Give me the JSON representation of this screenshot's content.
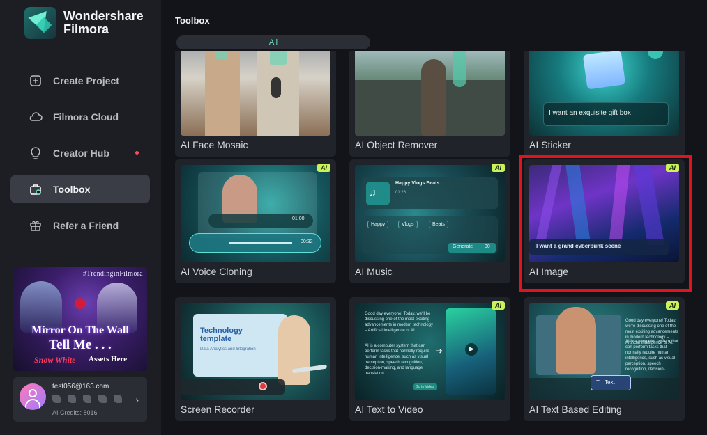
{
  "brand": {
    "name": "Wondershare\nFilmora"
  },
  "sidebar": {
    "items": [
      {
        "label": "Create Project",
        "icon": "plus-square-icon"
      },
      {
        "label": "Filmora Cloud",
        "icon": "cloud-icon"
      },
      {
        "label": "Creator Hub",
        "icon": "lightbulb-icon",
        "has_dot": true
      },
      {
        "label": "Toolbox",
        "icon": "toolbox-icon",
        "active": true
      },
      {
        "label": "Refer a Friend",
        "icon": "gift-icon"
      }
    ],
    "promo": {
      "tag": "#TrendinginFilmora",
      "line1": "Mirror On The Wall",
      "line2": "Tell Me . . .",
      "line3": "Snow White",
      "line4": "Assets Here"
    },
    "account": {
      "email": "test056@163.com",
      "credits": "AI Credits: 8016"
    }
  },
  "main": {
    "title": "Toolbox",
    "filter": "All",
    "cards": [
      {
        "caption": "AI Face Mosaic",
        "ai": false
      },
      {
        "caption": "AI Object Remover",
        "ai": false
      },
      {
        "caption": "AI Sticker",
        "ai": false,
        "prompt": "I want an exquisite gift box"
      },
      {
        "caption": "AI Voice Cloning",
        "ai": true,
        "badge": "AI",
        "t1": "01:00",
        "t2": "00:32"
      },
      {
        "caption": "AI Music",
        "ai": true,
        "badge": "AI",
        "song": "Happy Vlogs Beats",
        "time": "01:26",
        "tags": [
          "Happy",
          "Vlogs",
          "Beats"
        ],
        "generate": "Generate",
        "gen_count": "30"
      },
      {
        "caption": "AI Image",
        "ai": true,
        "badge": "AI",
        "prompt": "I want a grand cyberpunk scene"
      },
      {
        "caption": "Screen Recorder",
        "ai": false,
        "heading": "Technology template",
        "sub": "Data Analytics and Integration"
      },
      {
        "caption": "AI Text to Video",
        "ai": true,
        "badge": "AI",
        "para1": "Good day everyone! Today, we'll be discussing one of the most exciting advancements in modern technology – Artificial Intelligence or AI.",
        "para2": "AI is a computer system that can perform tasks that normally require human intelligence, such as visual perception, speech recognition, decision-making, and language translation.",
        "button": "Go to Video"
      },
      {
        "caption": "AI Text Based Editing",
        "ai": true,
        "badge": "AI",
        "para1": "Good day everyone! Today, we're discussing one of the most exciting advancements in modern technology – Artificial Intelligence or AI.",
        "para2": "AI is a computer system that can perform tasks that normally require human intelligence, such as visual perception, speech recognition, decision-making, and language translation. These abilities are made possible through learning algorithms and continuously learn and adapt.",
        "chip": "Text"
      }
    ]
  },
  "colors": {
    "accent": "#6be0c4",
    "highlight": "#e0141c",
    "ai_badge": "#c9f25b"
  }
}
